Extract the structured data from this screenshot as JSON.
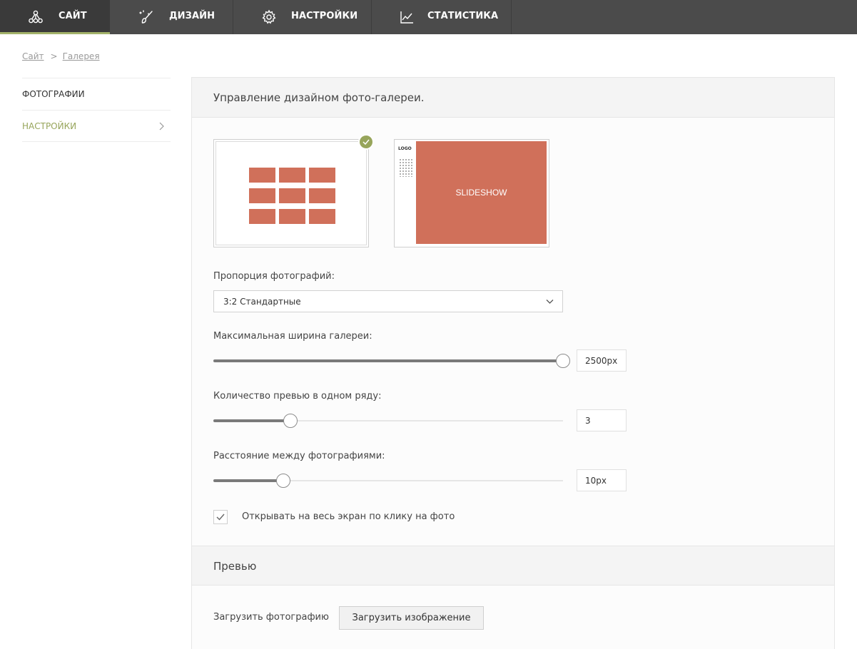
{
  "nav": {
    "tabs": [
      {
        "label": "САЙТ",
        "icon": "site-tree-icon",
        "active": true
      },
      {
        "label": "ДИЗАЙН",
        "icon": "brush-icon",
        "active": false
      },
      {
        "label": "НАСТРОЙКИ",
        "icon": "gear-icon",
        "active": false
      },
      {
        "label": "СТАТИСТИКА",
        "icon": "chart-icon",
        "active": false
      }
    ]
  },
  "breadcrumb": {
    "items": [
      "Сайт",
      "Галерея"
    ],
    "separator": ">"
  },
  "sidebar": {
    "items": [
      {
        "label": "ФОТОГРАФИИ",
        "active": false
      },
      {
        "label": "НАСТРОЙКИ",
        "active": true
      }
    ]
  },
  "panel": {
    "title": "Управление дизайном фото-галереи.",
    "layouts": [
      {
        "name": "grid",
        "selected": true
      },
      {
        "name": "slideshow",
        "selected": false,
        "logo_text": "LOGO",
        "stage_text": "SLIDESHOW"
      }
    ],
    "aspect": {
      "label": "Пропорция фотографий:",
      "value": "3:2 Стандартные"
    },
    "max_width": {
      "label": "Максимальная ширина галереи:",
      "value": "2500px",
      "fraction": 1.0
    },
    "per_row": {
      "label": "Количество превью в одном ряду:",
      "value": "3",
      "fraction": 0.22
    },
    "spacing": {
      "label": "Расстояние между фотографиями:",
      "value": "10px",
      "fraction": 0.2
    },
    "fullscreen": {
      "label": "Открывать на весь экран по клику на фото",
      "checked": true
    }
  },
  "preview": {
    "title": "Превью",
    "upload_label": "Загрузить фотографию",
    "upload_button": "Загрузить изображение"
  },
  "colors": {
    "accent": "#97a55b",
    "nav_bg": "#4b4b4b",
    "tile": "#d0705a"
  }
}
